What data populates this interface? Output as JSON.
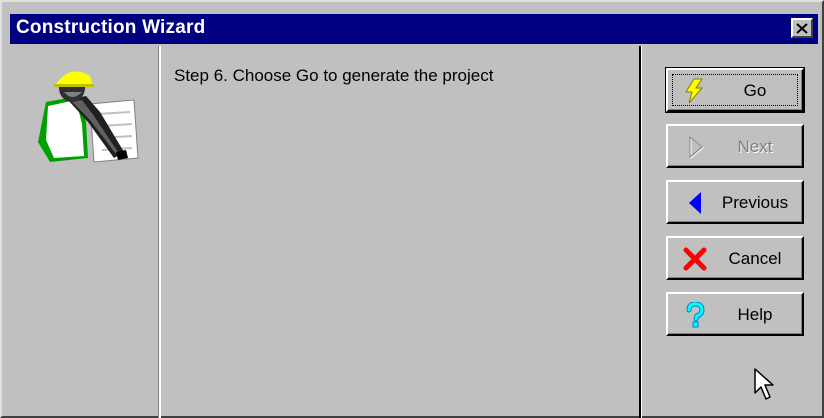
{
  "window": {
    "title": "Construction Wizard",
    "close_icon": "close-x-icon"
  },
  "wizard": {
    "image": "construction-worker-icon",
    "step_text": "Step 6. Choose Go to generate the project"
  },
  "buttons": [
    {
      "label": "Go",
      "icon": "lightning-bolt-icon",
      "enabled": true,
      "default": true
    },
    {
      "label": "Next",
      "icon": "next-arrow-icon",
      "enabled": false
    },
    {
      "label": "Previous",
      "icon": "previous-arrow-icon",
      "enabled": true
    },
    {
      "label": "Cancel",
      "icon": "cancel-x-icon",
      "enabled": true
    },
    {
      "label": "Help",
      "icon": "question-mark-icon",
      "enabled": true
    }
  ],
  "colors": {
    "titlebar": "#000080",
    "face": "#c0c0c0",
    "previous_arrow": "#0000ff",
    "cancel_x": "#ff0000",
    "help_question": "#00ffff",
    "go_bolt": "#ffff00"
  }
}
